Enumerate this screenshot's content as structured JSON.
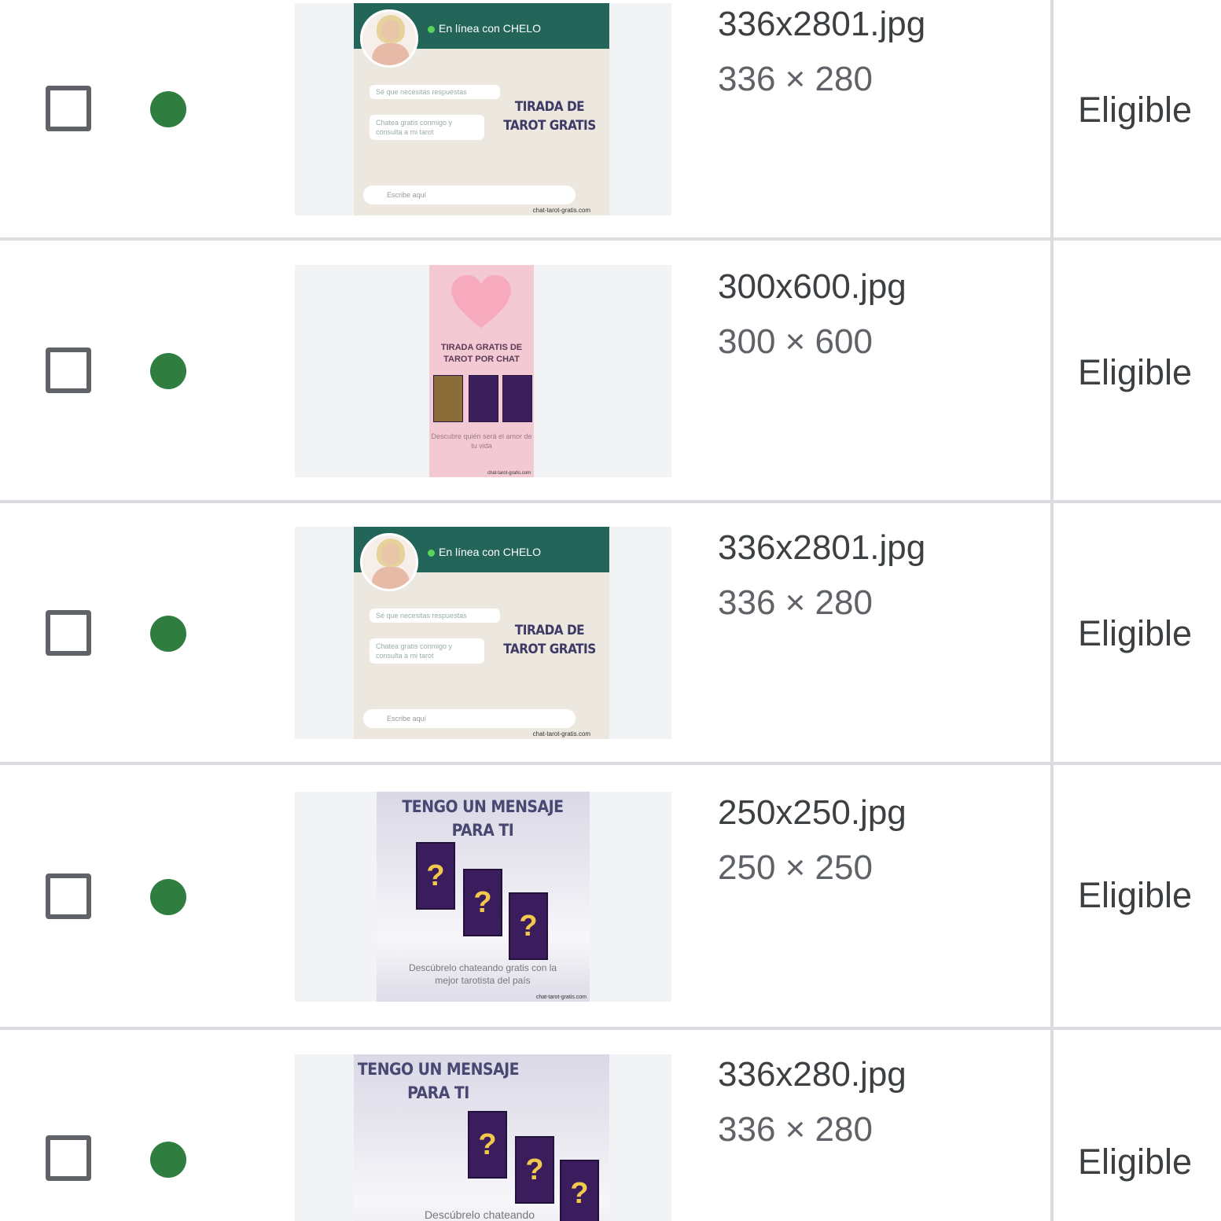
{
  "colors": {
    "status_eligible": "#2f7d3f",
    "divider": "#dadce0",
    "checkbox_border": "#5f6368"
  },
  "rows": [
    {
      "filename": "336x2801.jpg",
      "dimensions": "336 × 280",
      "status": "Eligible",
      "ad": {
        "online": "En línea con CHELO",
        "bubble1": "Sé que necesitas respuestas",
        "bubble2": "Chatea gratis conmigo y consulta a mi tarot",
        "title": "TIRADA DE TAROT GRATIS",
        "input": "Escribe aquí",
        "url": "chat-tarot-gratis.com"
      }
    },
    {
      "filename": "300x600.jpg",
      "dimensions": "300 × 600",
      "status": "Eligible",
      "ad": {
        "title": "TIRADA GRATIS DE TAROT POR CHAT",
        "sub": "Descubre quién será el amor de tu vida",
        "url": "chat-tarot-gratis.com"
      }
    },
    {
      "filename": "336x2801.jpg",
      "dimensions": "336 × 280",
      "status": "Eligible",
      "ad": {
        "online": "En línea con CHELO",
        "bubble1": "Sé que necesitas respuestas",
        "bubble2": "Chatea gratis conmigo y consulta a mi tarot",
        "title": "TIRADA DE TAROT GRATIS",
        "input": "Escribe aquí",
        "url": "chat-tarot-gratis.com"
      }
    },
    {
      "filename": "250x250.jpg",
      "dimensions": "250 × 250",
      "status": "Eligible",
      "ad": {
        "title": "TENGO UN MENSAJE PARA TI",
        "sub": "Descúbrelo chateando gratis con la mejor tarotista del país",
        "url": "chat-tarot-gratis.com"
      }
    },
    {
      "filename": "336x280.jpg",
      "dimensions": "336 × 280",
      "status": "Eligible",
      "ad": {
        "title": "TENGO UN MENSAJE PARA TI",
        "sub": "Descúbrelo chateando"
      }
    }
  ]
}
